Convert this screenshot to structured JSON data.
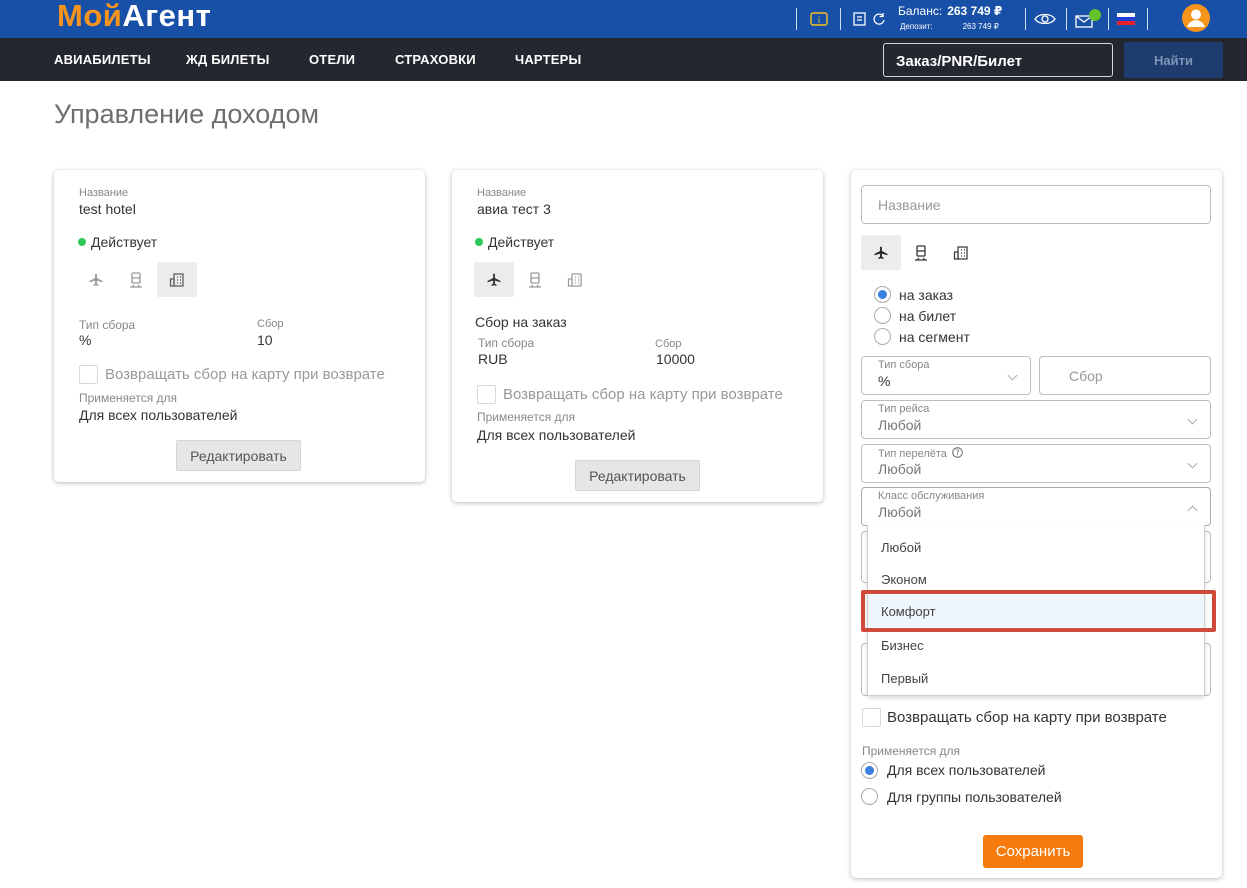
{
  "brand": {
    "part1": "Мой",
    "part2": "Агент"
  },
  "header": {
    "balance_label": "Баланс:",
    "balance_value": "263 749 ₽",
    "deposit_label": "Депозит:",
    "deposit_value": "263 749 ₽",
    "colors": {
      "primary": "#1850a8",
      "accent": "#f7941d",
      "online": "#62c42a"
    }
  },
  "nav": {
    "items": [
      "АВИАБИЛЕТЫ",
      "ЖД БИЛЕТЫ",
      "ОТЕЛИ",
      "СТРАХОВКИ",
      "ЧАРТЕРЫ"
    ],
    "search_value": "Заказ/PNR/Билет",
    "find_label": "Найти"
  },
  "page": {
    "title": "Управление доходом"
  },
  "card1": {
    "name_label": "Название",
    "name": "test hotel",
    "status": "Действует",
    "fee_type_label": "Тип сбора",
    "fee_type": "%",
    "fee_label": "Сбор",
    "fee": "10",
    "refund_label": "Возвращать сбор на карту при возврате",
    "applies_label": "Применяется для",
    "applies": "Для всех пользователей",
    "edit_label": "Редактировать"
  },
  "card2": {
    "name_label": "Название",
    "name": "авиа тест 3",
    "status": "Действует",
    "mode": "Сбор на заказ",
    "fee_type_label": "Тип сбора",
    "fee_type": "RUB",
    "fee_label": "Сбор",
    "fee": "10000",
    "refund_label": "Возвращать сбор на карту при возврате",
    "applies_label": "Применяется для",
    "applies": "Для всех пользователей",
    "edit_label": "Редактировать"
  },
  "form": {
    "name_placeholder": "Название",
    "options": [
      "на заказ",
      "на билет",
      "на сегмент"
    ],
    "fee_type_label": "Тип сбора",
    "fee_type": "%",
    "fee_placeholder": "Сбор",
    "trip_type_label": "Тип рейса",
    "trip_type": "Любой",
    "flight_type_label": "Тип перелёта",
    "flight_type": "Любой",
    "class_label": "Класс обслуживания",
    "class_value": "Любой",
    "class_options": [
      "Любой",
      "Эконом",
      "Комфорт",
      "Бизнес",
      "Первый"
    ],
    "refund_label": "Возвращать сбор на карту при возврате",
    "applies_label": "Применяется для",
    "applies_options": [
      "Для всех пользователей",
      "Для группы пользователей"
    ],
    "save_label": "Сохранить"
  }
}
